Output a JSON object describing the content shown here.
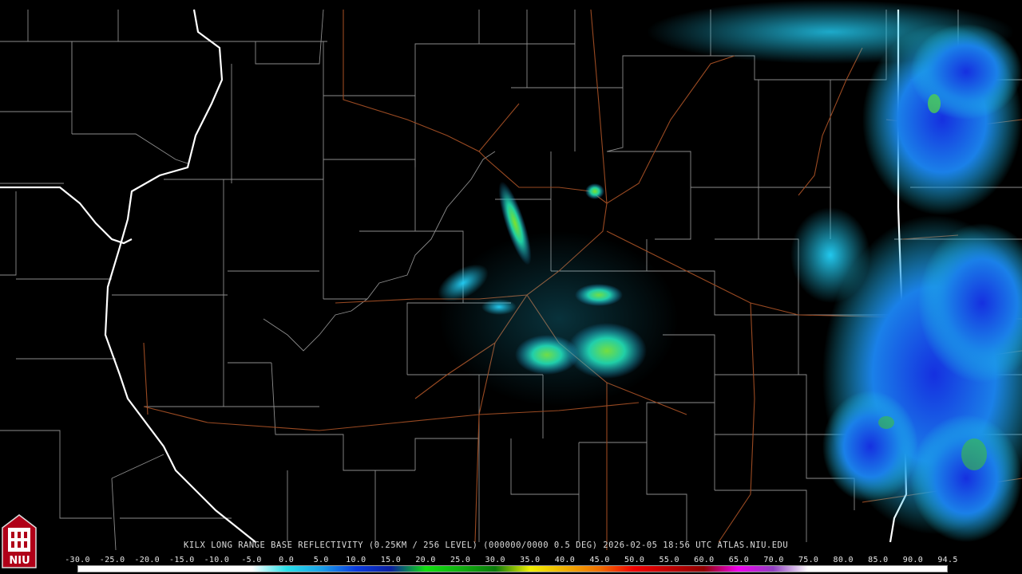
{
  "radar": {
    "caption": "KILX LONG RANGE BASE REFLECTIVITY (0.25KM / 256 LEVEL) (000000/0000 0.5 DEG) 2026-02-05 18:56 UTC  ATLAS.NIU.EDU"
  },
  "legend": {
    "ticks": [
      "-30.0",
      "-25.0",
      "-20.0",
      "-15.0",
      "-10.0",
      "-5.0",
      "0.0",
      "5.0",
      "10.0",
      "15.0",
      "20.0",
      "25.0",
      "30.0",
      "35.0",
      "40.0",
      "45.0",
      "50.0",
      "55.0",
      "60.0",
      "65.0",
      "70.0",
      "75.0",
      "80.0",
      "85.0",
      "90.0",
      "94.5"
    ],
    "colors": [
      "#ffffff",
      "#ffffff",
      "#ffffff",
      "#ffffff",
      "#ffffff",
      "#ffffff",
      "#28e0e8",
      "#1aa0e8",
      "#0a3ae0",
      "#0a20a0",
      "#10e010",
      "#10b010",
      "#0a7a0a",
      "#f0f000",
      "#f0b000",
      "#f07000",
      "#f00000",
      "#c00000",
      "#900000",
      "#f000f0",
      "#9040c0",
      "#ffffff",
      "#ffffff",
      "#ffffff",
      "#ffffff",
      "#ffffff"
    ]
  },
  "logo": {
    "text": "NIU"
  }
}
